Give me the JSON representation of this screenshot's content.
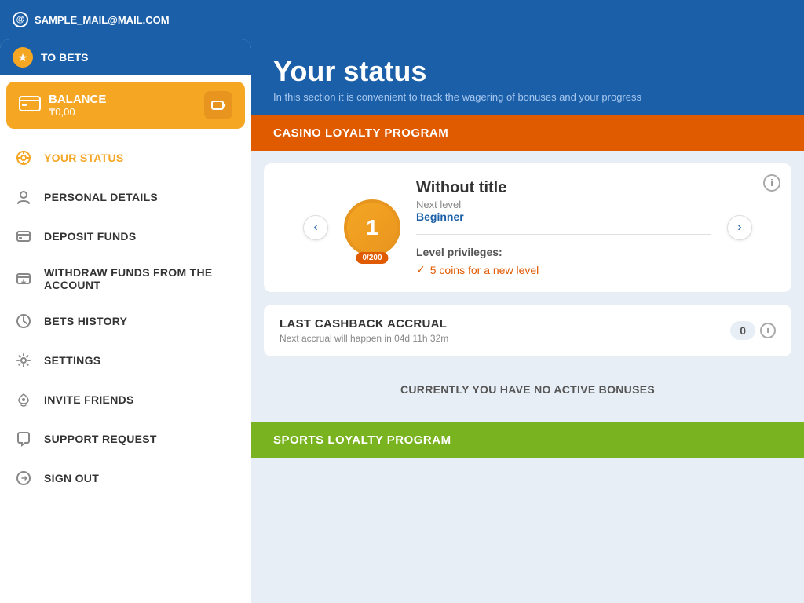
{
  "header": {
    "email": "SAMPLE_MAIL@MAIL.COM"
  },
  "sidebar": {
    "to_bets_label": "TO BETS",
    "balance": {
      "label": "BALANCE",
      "amount": "₸0,00"
    },
    "menu_items": [
      {
        "id": "your-status",
        "label": "YOUR STATUS",
        "icon": "⚙",
        "active": true
      },
      {
        "id": "personal-details",
        "label": "PERSONAL DETAILS",
        "icon": "👤",
        "active": false
      },
      {
        "id": "deposit-funds",
        "label": "DEPOSIT FUNDS",
        "icon": "💳",
        "active": false
      },
      {
        "id": "withdraw-funds",
        "label": "WITHDRAW FUNDS FROM THE ACCOUNT",
        "icon": "💸",
        "active": false
      },
      {
        "id": "bets-history",
        "label": "BETS HISTORY",
        "icon": "🕐",
        "active": false
      },
      {
        "id": "settings",
        "label": "SETTINGS",
        "icon": "⚙",
        "active": false
      },
      {
        "id": "invite-friends",
        "label": "INVITE FRIENDS",
        "icon": "💝",
        "active": false
      },
      {
        "id": "support-request",
        "label": "SUPPORT REQUEST",
        "icon": "💬",
        "active": false
      },
      {
        "id": "sign-out",
        "label": "SIGN OUT",
        "icon": "↩",
        "active": false
      }
    ]
  },
  "main": {
    "title": "Your status",
    "subtitle": "In this section it is convenient to track the wagering of bonuses and your progress",
    "casino_loyalty": {
      "section_title": "CASINO LOYALTY PROGRAM",
      "level": {
        "number": "1",
        "progress": "0/200",
        "title": "Without title",
        "next_level_label": "Next level",
        "next_level_value": "Beginner",
        "privileges_label": "Level privileges:",
        "privilege": "5 coins for a new level"
      }
    },
    "cashback": {
      "title": "LAST CASHBACK ACCRUAL",
      "subtitle": "Next accrual will happen in 04d 11h 32m",
      "amount": "0"
    },
    "no_bonuses": {
      "label": "CURRENTLY YOU HAVE NO ACTIVE BONUSES"
    },
    "sports_loyalty": {
      "section_title": "SPORTS LOYALTY PROGRAM"
    }
  }
}
